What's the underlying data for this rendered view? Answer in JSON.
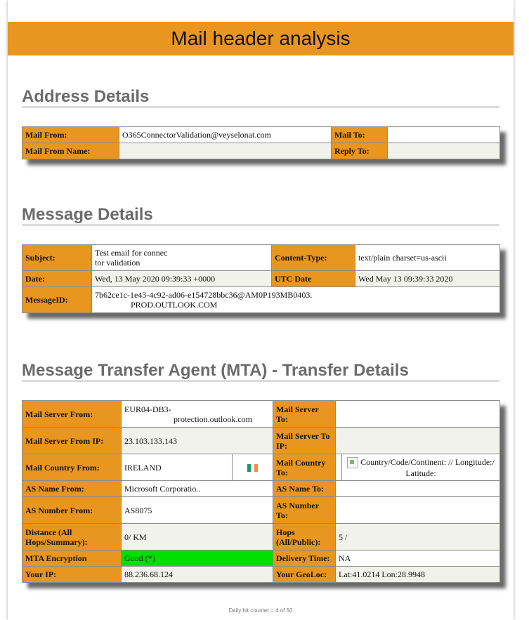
{
  "banner": {
    "title": "Mail header analysis"
  },
  "address": {
    "title": "Address Details",
    "mail_from_label": "Mail From:",
    "mail_from_value": "O365ConnectorValidation@veyselonat.com",
    "mail_to_label": "Mail To:",
    "mail_to_value": "",
    "mail_from_name_label": "Mail From Name:",
    "mail_from_name_value": "",
    "reply_to_label": "Reply To:",
    "reply_to_value": ""
  },
  "message": {
    "title": "Message Details",
    "subject_label": "Subject:",
    "subject_line1": "Test email for connec",
    "subject_line2": "tor validation",
    "content_type_label": "Content-Type:",
    "content_type_value": "text/plain charset=us-ascii",
    "date_label": "Date:",
    "date_value": "Wed, 13 May 2020 09:39:33 +0000",
    "utc_label": "UTC Date",
    "utc_value": "Wed May 13 09:39:33 2020",
    "msgid_label": "MessageID:",
    "msgid_line1": "7b62ce1c-1e43-4c92-ad06-e154728bbc36@AM0P193MB0403.",
    "msgid_line2": "PROD.OUTLOOK.COM"
  },
  "mta": {
    "title": "Message Transfer Agent (MTA) - Transfer Details",
    "server_from_label": "Mail Server From:",
    "server_from_line1": "EUR04-DB3-",
    "server_from_line2": "protection.outlook.com",
    "server_to_label": "Mail Server To:",
    "server_to_value": "",
    "server_from_ip_label": "Mail Server From IP:",
    "server_from_ip_value": "23.103.133.143",
    "server_to_ip_label": "Mail Server To IP:",
    "server_to_ip_value": "",
    "country_from_label": "Mail Country From:",
    "country_from_value": "IRELAND",
    "country_to_label": "Mail Country To:",
    "country_to_value": "Country/Code/Continent: // Longitude:/ Latitude:",
    "as_name_from_label": "AS Name From:",
    "as_name_from_value": "Microsoft Corporatio..",
    "as_name_to_label": "AS Name To:",
    "as_name_to_value": "",
    "as_number_from_label": "AS Number From:",
    "as_number_from_value": "AS8075",
    "as_number_to_label": "AS Number To:",
    "as_number_to_value": "",
    "distance_label": "Distance (All Hops/Summary):",
    "distance_value": "0/ KM",
    "hops_label": "Hops (All/Public):",
    "hops_value": "5 /",
    "encryption_label": "MTA Encryption",
    "encryption_value": "Good (*)",
    "delivery_label": "Delivery Time:",
    "delivery_value": "NA",
    "your_ip_label": "Your IP:",
    "your_ip_value": "88.236.68.124",
    "geoloc_label": "Your GeoLoc:",
    "geoloc_value": "Lat:41.0214 Lon:28.9948"
  },
  "footer": {
    "counter": "Daily hit counter = 4 of 50"
  },
  "colors": {
    "accent": "#e8961f",
    "good": "#00e000",
    "heading": "#6b6b6b"
  }
}
